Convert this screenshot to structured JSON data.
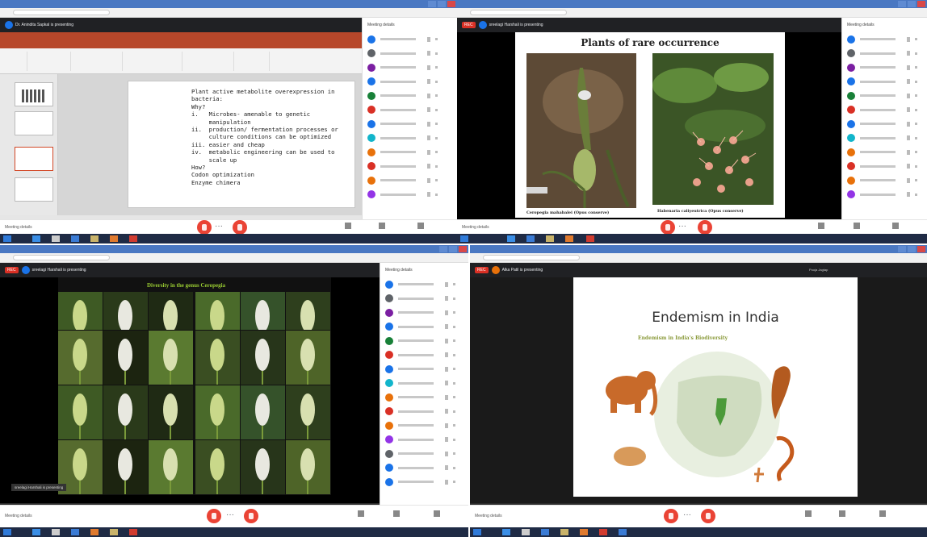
{
  "q1": {
    "meeting_name": "Dr. Anindita Sapkal is presenting",
    "slide_text": [
      "Plant active metabolite overexpression in",
      "bacteria:",
      "Why?",
      "i.   Microbes- amenable to genetic",
      "     manipulation",
      "ii.  production/ fermentation processes or",
      "     culture conditions can be optimized",
      "iii. easier and cheap",
      "iv.  metabolic engineering can be used to",
      "     scale up",
      "How?",
      "Codon optimization",
      "Enzyme chimera"
    ],
    "panel_title": "Meeting details"
  },
  "q2": {
    "meeting_name": "sreelagi Harshali is presenting",
    "slide_title": "Plants of rare occurrence",
    "caption_left": "Ceropegia mahabalei (Opus conserve)",
    "caption_right": "Habenaria caliyeutrica (Opus conserve)",
    "left_photo_label": "Ceropegia",
    "panel_title": "Meeting details"
  },
  "q3": {
    "meeting_name": "sreelagi Harshali is presenting",
    "slide_title": "Diversity in the genus Ceropegia",
    "caption": "sreelagi Harshali is presenting",
    "panel_title": "Meeting details"
  },
  "q4": {
    "meeting_name": "Alka Patil is presenting",
    "slide_title": "Endemism in India",
    "slide_subtitle": "Endemism in India's Biodiversity",
    "presenter_tag": "Pooja Jagtap",
    "panel_title": "Meeting details"
  },
  "controls": {
    "meeting_details": "Meeting details",
    "ellipsis": "···"
  },
  "colors": {
    "powerpoint": "#b7472a",
    "meet_red": "#ea4335",
    "title_blue": "#4a78c2",
    "taskbar": "#1f2b45"
  },
  "icons": [
    "mic-off-icon",
    "hangup-icon",
    "present-icon",
    "people-icon",
    "chat-icon"
  ]
}
